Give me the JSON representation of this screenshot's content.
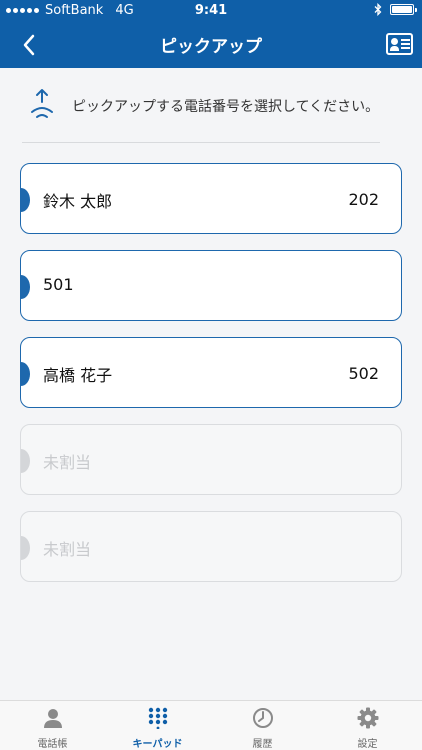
{
  "status_bar": {
    "carrier": "SoftBank",
    "network": "4G",
    "time": "9:41"
  },
  "nav": {
    "title": "ピックアップ"
  },
  "instruction": {
    "text": "ピックアップする電話番号を選択してください。"
  },
  "extensions": [
    {
      "name": "鈴木 太郎",
      "number": "202",
      "assigned": true
    },
    {
      "name": "501",
      "number": "",
      "assigned": true
    },
    {
      "name": "高橋 花子",
      "number": "502",
      "assigned": true
    },
    {
      "name": "未割当",
      "number": "",
      "assigned": false
    },
    {
      "name": "未割当",
      "number": "",
      "assigned": false
    }
  ],
  "tabbar": {
    "items": [
      {
        "label": "電話帳",
        "icon": "person-icon",
        "active": false
      },
      {
        "label": "キーパッド",
        "icon": "keypad-icon",
        "active": true
      },
      {
        "label": "履歴",
        "icon": "clock-icon",
        "active": false
      },
      {
        "label": "設定",
        "icon": "gear-icon",
        "active": false
      }
    ]
  },
  "colors": {
    "brand": "#0f5fa8",
    "item_border": "#1e68ad",
    "disabled": "#dadcdf"
  }
}
